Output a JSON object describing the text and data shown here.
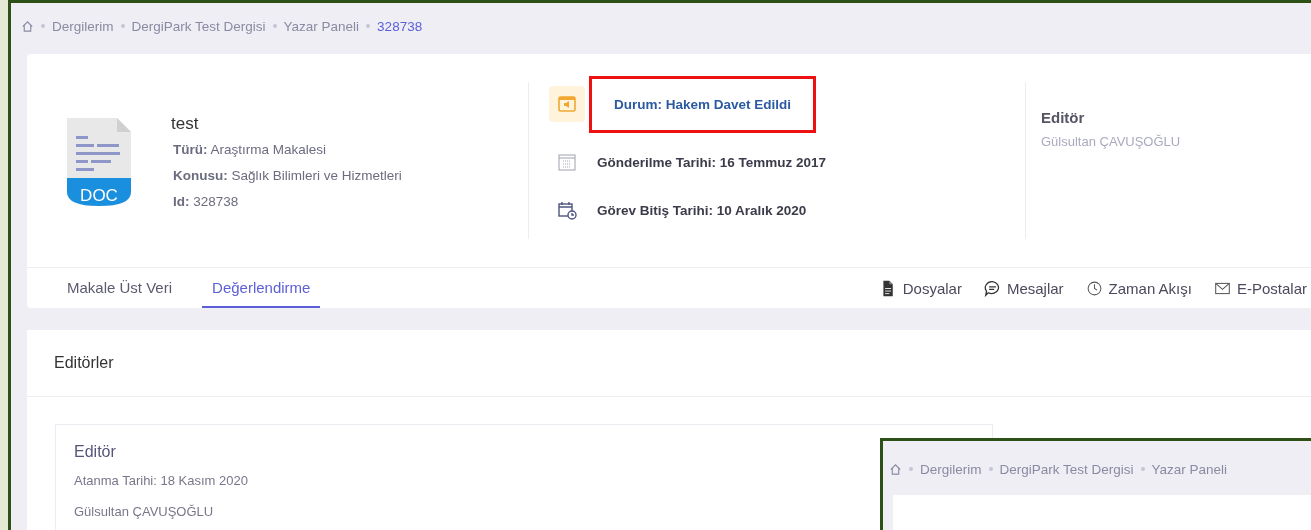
{
  "breadcrumb": [
    {
      "label": "Dergilerim",
      "current": false
    },
    {
      "label": "DergiPark Test Dergisi",
      "current": false
    },
    {
      "label": "Yazar Paneli",
      "current": false
    },
    {
      "label": "328738",
      "current": true
    }
  ],
  "article": {
    "file_type": "DOC",
    "title": "test",
    "fields": [
      {
        "label": "Türü:",
        "value": "Araştırma Makalesi"
      },
      {
        "label": "Konusu:",
        "value": "Sağlık Bilimleri ve Hizmetleri"
      },
      {
        "label": "Id:",
        "value": "328738"
      }
    ]
  },
  "status_items": [
    {
      "kind": "status",
      "text": "Durum: Hakem Davet Edildi",
      "highlighted": true
    },
    {
      "kind": "submitted",
      "text": "Gönderilme Tarihi: 16 Temmuz 2017",
      "highlighted": false
    },
    {
      "kind": "deadline",
      "text": "Görev Bitiş Tarihi: 10 Aralık 2020",
      "highlighted": false
    }
  ],
  "editor": {
    "role": "Editör",
    "name": "Gülsultan ÇAVUŞOĞLU"
  },
  "tabs": [
    {
      "label": "Makale Üst Veri",
      "selected": false
    },
    {
      "label": "Değerlendirme",
      "selected": true
    }
  ],
  "actions": [
    {
      "kind": "files",
      "label": "Dosyalar"
    },
    {
      "kind": "messages",
      "label": "Mesajlar"
    },
    {
      "kind": "timeline",
      "label": "Zaman Akışı"
    },
    {
      "kind": "emails",
      "label": "E-Postalar"
    }
  ],
  "editors_section": {
    "title": "Editörler",
    "cards": [
      {
        "role": "Editör",
        "assigned": "Atanma Tarihi: 18 Kasım 2020",
        "name": "Gülsultan ÇAVUŞOĞLU"
      }
    ]
  },
  "inset": {
    "breadcrumb": [
      {
        "label": "Dergilerim",
        "current": false
      },
      {
        "label": "DergiPark Test Dergisi",
        "current": false
      },
      {
        "label": "Yazar Paneli",
        "current": false
      }
    ]
  }
}
